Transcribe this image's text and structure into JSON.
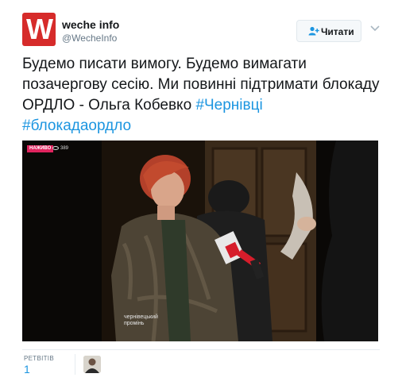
{
  "account": {
    "name": "weche info",
    "handle": "@WecheInfo",
    "avatar_letter": "W",
    "brand_color": "#d62b2a"
  },
  "follow_button": {
    "label": "Читати",
    "icon": "add-user-icon"
  },
  "menu": {
    "icon": "chevron-down-icon"
  },
  "tweet": {
    "text": "Будемо писати вимогу. Будемо вимагати позачергову сесію. Ми повинні підтримати блокаду ОРДЛО - Ольга Кобевко ",
    "hashtags": [
      "#Чернівці",
      "#блокадаордло"
    ],
    "link_color": "#1b95e0"
  },
  "video": {
    "live_badge": "НАЖИВО",
    "viewer_count": "389",
    "watermark": "чернівецький\nпромінь"
  },
  "stats": {
    "retweets_label": "РЕТВІТІВ",
    "retweets_count": "1"
  }
}
